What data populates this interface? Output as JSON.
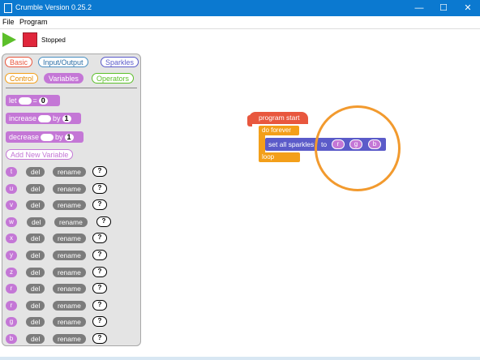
{
  "window": {
    "title": "Crumble Version 0.25.2",
    "minimize": "—",
    "maximize": "☐",
    "close": "✕"
  },
  "menu": {
    "file": "File",
    "program": "Program"
  },
  "toolbar": {
    "status": "Stopped"
  },
  "palette": {
    "categories": {
      "basic": "Basic",
      "io": "Input/Output",
      "sparkles": "Sparkles",
      "control": "Control",
      "variables": "Variables",
      "operators": "Operators"
    },
    "blocks": {
      "let": "let",
      "let_eq": "=",
      "let_val": "0",
      "increase": "increase",
      "increase_by": "by",
      "increase_val": "1",
      "decrease": "decrease",
      "decrease_by": "by",
      "decrease_val": "1",
      "add_variable": "Add New Variable"
    },
    "del_label": "del",
    "rename_label": "rename",
    "help_label": "?",
    "variables": [
      "t",
      "u",
      "v",
      "w",
      "x",
      "y",
      "z",
      "r",
      "r",
      "g",
      "b"
    ]
  },
  "program": {
    "start": "program start",
    "forever": "do forever",
    "set_sparkles": "set all sparkles",
    "to": "to",
    "rgb": [
      "r",
      "g",
      "b"
    ],
    "loop": "loop"
  },
  "colors": {
    "titlebar": "#0b79d0",
    "variables": "#c477d6",
    "start_block": "#e8573e",
    "control_block": "#f39f1a",
    "sparkle_block": "#5b5bc9",
    "highlight_circle": "#f29a2e"
  }
}
